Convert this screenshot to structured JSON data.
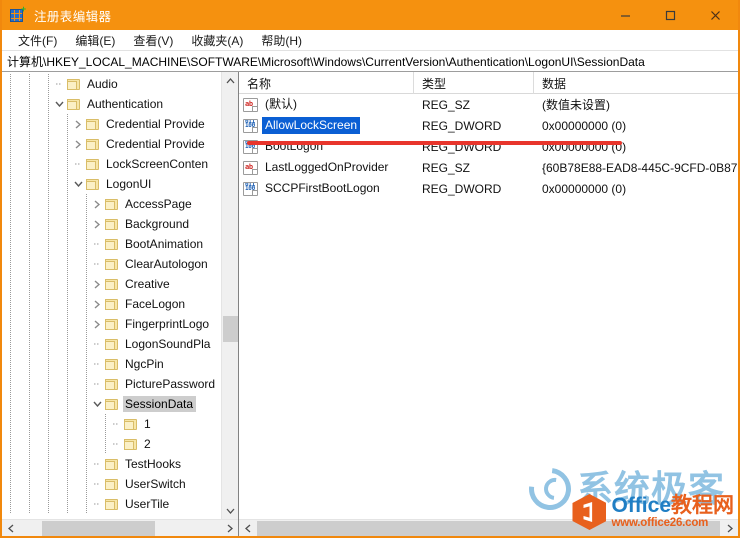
{
  "window": {
    "title": "注册表编辑器",
    "icon": "registry-editor-icon",
    "accent_color": "#f5910f",
    "controls": {
      "minimize": "minimize-icon",
      "maximize": "maximize-icon",
      "close": "close-icon"
    }
  },
  "menubar": {
    "items": [
      {
        "label": "文件(F)"
      },
      {
        "label": "编辑(E)"
      },
      {
        "label": "查看(V)"
      },
      {
        "label": "收藏夹(A)"
      },
      {
        "label": "帮助(H)"
      }
    ]
  },
  "addressbar": {
    "path": "计算机\\HKEY_LOCAL_MACHINE\\SOFTWARE\\Microsoft\\Windows\\CurrentVersion\\Authentication\\LogonUI\\SessionData"
  },
  "tree": {
    "items": [
      {
        "label": "Audio",
        "depth": 3,
        "twisty": "none",
        "selected": false
      },
      {
        "label": "Authentication",
        "depth": 3,
        "twisty": "expanded",
        "selected": false
      },
      {
        "label": "Credential Provide",
        "depth": 4,
        "twisty": "collapsed",
        "selected": false
      },
      {
        "label": "Credential Provide",
        "depth": 4,
        "twisty": "collapsed",
        "selected": false
      },
      {
        "label": "LockScreenConten",
        "depth": 4,
        "twisty": "none",
        "selected": false
      },
      {
        "label": "LogonUI",
        "depth": 4,
        "twisty": "expanded",
        "selected": false
      },
      {
        "label": "AccessPage",
        "depth": 5,
        "twisty": "collapsed",
        "selected": false
      },
      {
        "label": "Background",
        "depth": 5,
        "twisty": "collapsed",
        "selected": false
      },
      {
        "label": "BootAnimation",
        "depth": 5,
        "twisty": "none",
        "selected": false
      },
      {
        "label": "ClearAutologon",
        "depth": 5,
        "twisty": "none",
        "selected": false
      },
      {
        "label": "Creative",
        "depth": 5,
        "twisty": "collapsed",
        "selected": false
      },
      {
        "label": "FaceLogon",
        "depth": 5,
        "twisty": "collapsed",
        "selected": false
      },
      {
        "label": "FingerprintLogo",
        "depth": 5,
        "twisty": "collapsed",
        "selected": false
      },
      {
        "label": "LogonSoundPla",
        "depth": 5,
        "twisty": "none",
        "selected": false
      },
      {
        "label": "NgcPin",
        "depth": 5,
        "twisty": "none",
        "selected": false
      },
      {
        "label": "PicturePassword",
        "depth": 5,
        "twisty": "none",
        "selected": false
      },
      {
        "label": "SessionData",
        "depth": 5,
        "twisty": "expanded",
        "selected": true
      },
      {
        "label": "1",
        "depth": 6,
        "twisty": "none",
        "selected": false
      },
      {
        "label": "2",
        "depth": 6,
        "twisty": "none",
        "selected": false
      },
      {
        "label": "TestHooks",
        "depth": 5,
        "twisty": "none",
        "selected": false
      },
      {
        "label": "UserSwitch",
        "depth": 5,
        "twisty": "none",
        "selected": false
      },
      {
        "label": "UserTile",
        "depth": 5,
        "twisty": "none",
        "selected": false
      }
    ]
  },
  "list": {
    "columns": {
      "name": "名称",
      "type": "类型",
      "data": "数据"
    },
    "rows": [
      {
        "icon": "string-value-icon",
        "name": "(默认)",
        "type": "REG_SZ",
        "data": "(数值未设置)",
        "selected": false
      },
      {
        "icon": "dword-value-icon",
        "name": "AllowLockScreen",
        "type": "REG_DWORD",
        "data": "0x00000000 (0)",
        "selected": true
      },
      {
        "icon": "dword-value-icon",
        "name": "BootLogon",
        "type": "REG_DWORD",
        "data": "0x00000000 (0)",
        "selected": false
      },
      {
        "icon": "string-value-icon",
        "name": "LastLoggedOnProvider",
        "type": "REG_SZ",
        "data": "{60B78E88-EAD8-445C-9CFD-0B87",
        "selected": false
      },
      {
        "icon": "dword-value-icon",
        "name": "SCCPFirstBootLogon",
        "type": "REG_DWORD",
        "data": "0x00000000 (0)",
        "selected": false
      }
    ]
  },
  "annotation": {
    "color": "#e8352c",
    "type": "underline-highlight"
  },
  "watermarks": {
    "center": {
      "text": "系统极客",
      "color": "#79b6dd"
    },
    "corner": {
      "brand_en": "Office",
      "brand_cn": "教程网",
      "url": "www.office26.com",
      "color_blue": "#1f7ec4",
      "color_orange": "#e8601d"
    }
  }
}
